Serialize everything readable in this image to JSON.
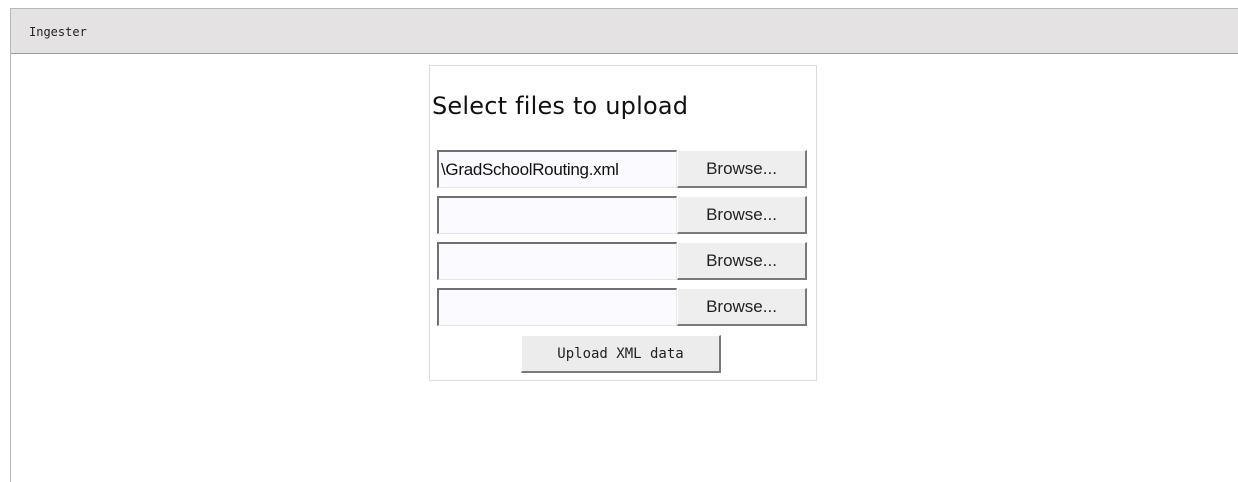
{
  "titlebar": {
    "title": "Ingester"
  },
  "panel": {
    "heading": "Select files to upload",
    "file_rows": [
      {
        "value": "\\GradSchoolRouting.xml",
        "browse_label": "Browse..."
      },
      {
        "value": "",
        "browse_label": "Browse..."
      },
      {
        "value": "",
        "browse_label": "Browse..."
      },
      {
        "value": "",
        "browse_label": "Browse..."
      }
    ],
    "upload_label": "Upload XML data"
  },
  "colors": {
    "titlebar_bg": "#e4e2e2",
    "button_bg": "#eeeeee",
    "input_bg": "#fbfaff"
  }
}
